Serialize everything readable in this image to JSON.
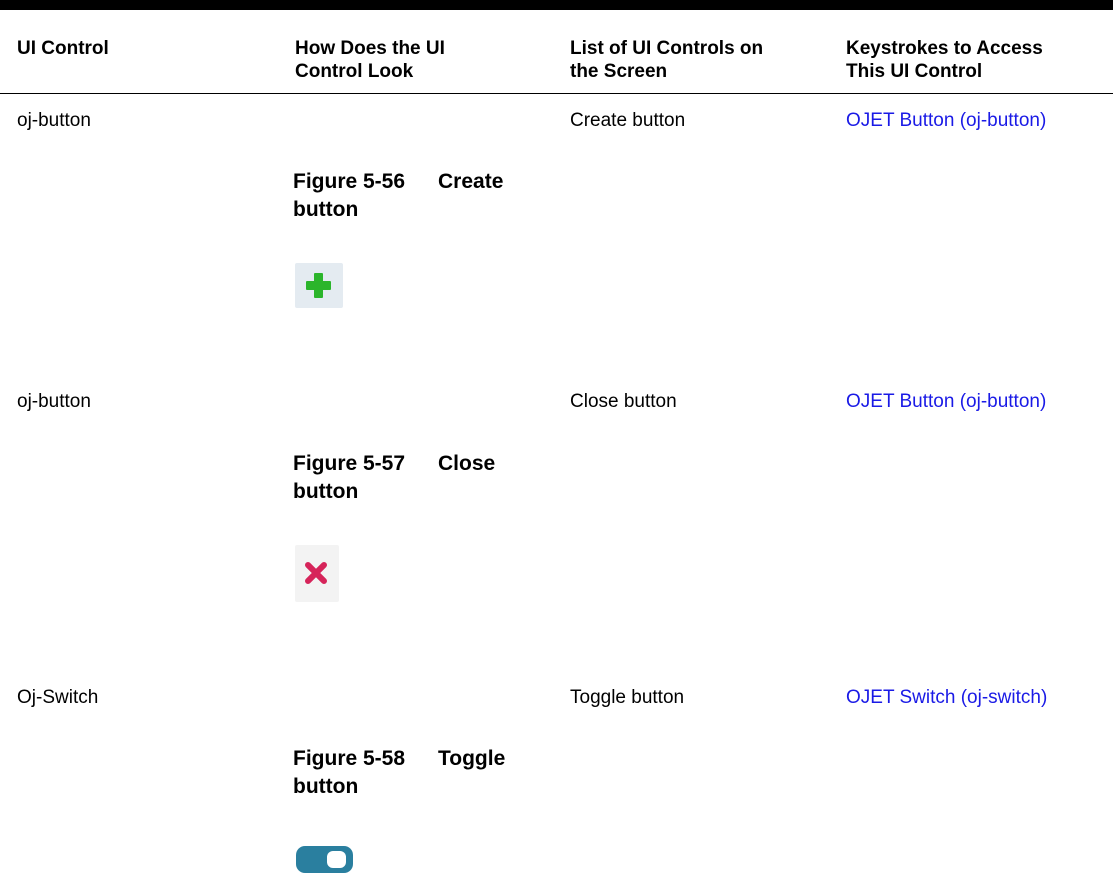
{
  "table": {
    "headers": {
      "col1": "UI Control",
      "col2_line1": "How Does the UI",
      "col2_line2": "Control Look",
      "col3_line1": "List of UI Controls on",
      "col3_line2": "the Screen",
      "col4_line1": "Keystrokes to Access",
      "col4_line2": "This UI Control"
    },
    "rows": [
      {
        "control": "oj-button",
        "figure_label": "Figure 5-56",
        "figure_title_1": "Create",
        "figure_title_2": "button",
        "icon": "plus-icon",
        "list_item": "Create button",
        "link": "OJET Button (oj-button)"
      },
      {
        "control": "oj-button",
        "figure_label": "Figure 5-57",
        "figure_title_1": "Close",
        "figure_title_2": "button",
        "icon": "close-x-icon",
        "list_item": "Close button",
        "link": "OJET Button (oj-button)"
      },
      {
        "control": "Oj-Switch",
        "figure_label": "Figure 5-58",
        "figure_title_1": "Toggle",
        "figure_title_2": "button",
        "icon": "toggle-switch-icon",
        "list_item": "Toggle button",
        "link": "OJET Switch (oj-switch)"
      }
    ]
  },
  "colors": {
    "link": "#1a1ae6",
    "plus_icon": "#2bb52b",
    "close_icon": "#d6245a",
    "toggle": "#2a7f9f"
  }
}
